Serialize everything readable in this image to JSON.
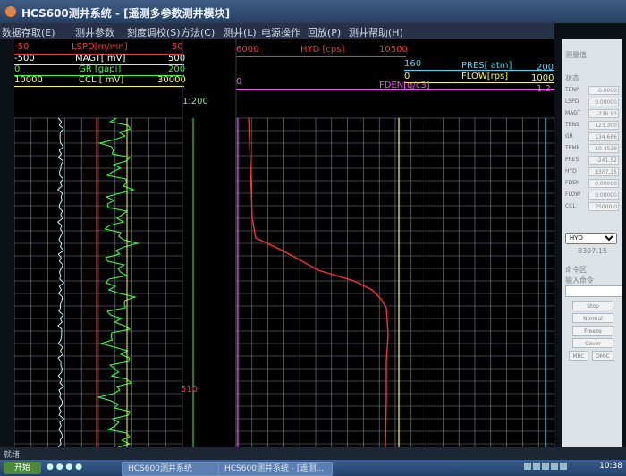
{
  "window": {
    "title": "HCS600测井系统 - [遥测多参数测井模块]"
  },
  "menu": [
    {
      "label": "数据存取(E)"
    },
    {
      "label": "测井参数"
    },
    {
      "label": "刻度调校(S)"
    },
    {
      "label": "方法(C)"
    },
    {
      "label": "测井(L)"
    },
    {
      "label": "电源操作"
    },
    {
      "label": "回放(P)"
    },
    {
      "label": "测井帮助(H)"
    }
  ],
  "curves_left": [
    {
      "name": "LSPD[m/mn]",
      "min": "-50",
      "max": "50",
      "color": "#ff3030"
    },
    {
      "name": "MAGT[ mV]",
      "min": "-500",
      "max": "500",
      "color": "#ffffff"
    },
    {
      "name": "GR [gapi]",
      "min": "0",
      "max": "200",
      "color": "#39ff39"
    },
    {
      "name": "CCL [ mV]",
      "min": "10000",
      "max": "30000",
      "color": "#ffff30"
    }
  ],
  "curves_right": [
    {
      "name": "HYD [cps]",
      "min": "6000",
      "max": "10500",
      "color": "#ff3030"
    },
    {
      "name": "PRES[ atm]",
      "min": "160",
      "max": "200",
      "color": "#30e0ff"
    },
    {
      "name": "FLOW[rps]",
      "min": "0",
      "max": "1000",
      "color": "#ffff30"
    },
    {
      "name": "FDEN[g/c3]",
      "min": "0",
      "max": "1.2",
      "color": "#ff4fff"
    }
  ],
  "depth": {
    "scale": "1:200",
    "mark": "510"
  },
  "side": {
    "section_value": "测量值",
    "section_state": "状态",
    "params": [
      {
        "name": "TENP",
        "value": "0.0000"
      },
      {
        "name": "LSPD",
        "value": "0.00000"
      },
      {
        "name": "MAGT",
        "value": "-236.93"
      },
      {
        "name": "TENS",
        "value": "123.300"
      },
      {
        "name": "GR",
        "value": "134.666"
      },
      {
        "name": "TEMP",
        "value": "10.4529"
      },
      {
        "name": "PRES",
        "value": "-241.52"
      },
      {
        "name": "HYD",
        "value": "8307.15"
      },
      {
        "name": "FDEN",
        "value": "0.00000"
      },
      {
        "name": "FLOW",
        "value": "0.00000"
      },
      {
        "name": "CCL",
        "value": "25000.0"
      }
    ],
    "select_value": "HYD",
    "depth_value": "8307.15",
    "command_section": "命令区",
    "input_label": "输入命令",
    "buttons": [
      "Stop",
      "Normal",
      "Freeze",
      "Cover"
    ],
    "small_buttons": [
      "MRC",
      "OMIC"
    ]
  },
  "status": {
    "text": "就绪"
  },
  "taskbar": {
    "start": "开始",
    "tasks": [
      "HCS600测井系统",
      "HCS600测井系统 - [遥测..."
    ],
    "clock": "10:38"
  },
  "chart_data": {
    "type": "line",
    "ylabel": "",
    "depth_marker": "510",
    "x_grid": true,
    "series": [
      {
        "name": "HYD [cps]",
        "color": "#ff3030"
      },
      {
        "name": "FLOW[rps]",
        "color": "#ffff30"
      },
      {
        "name": "FDEN[g/c3]",
        "color": "#ff4fff"
      },
      {
        "name": "PRES[ atm]",
        "color": "#30e0ff"
      },
      {
        "name": "GR [gapi]",
        "color": "#39ff39"
      },
      {
        "name": "MAGT[ mV]",
        "color": "#ffffff"
      },
      {
        "name": "LSPD[m/mn]",
        "color": "#ff3030"
      },
      {
        "name": "CCL [ mV]",
        "color": "#ffff30"
      }
    ]
  }
}
